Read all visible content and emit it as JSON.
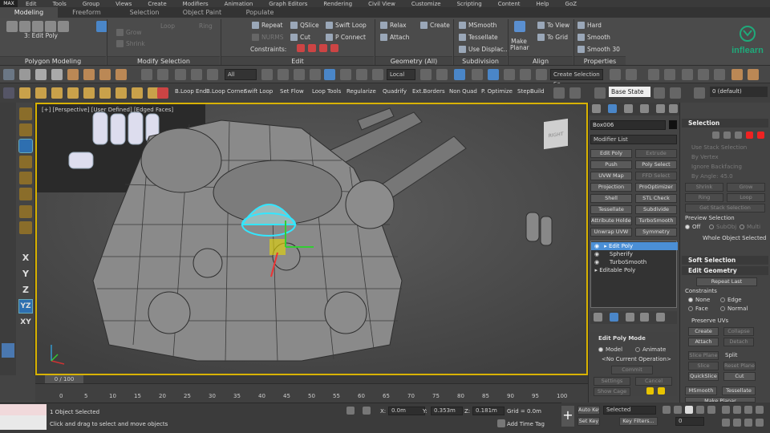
{
  "menubar": {
    "logo": "MAX",
    "items": [
      "Edit",
      "Tools",
      "Group",
      "Views",
      "Create",
      "Modifiers",
      "Animation",
      "Graph Editors",
      "Rendering",
      "Civil View",
      "Customize",
      "Scripting",
      "Content",
      "Help",
      "GoZ"
    ]
  },
  "ribbon_tabs": [
    "Modeling",
    "Freeform",
    "Selection",
    "Object Paint",
    "Populate"
  ],
  "ribbon": {
    "edit_poly_label": "3: Edit Poly",
    "panels": [
      "Polygon Modeling",
      "Modify Selection",
      "Edit",
      "Geometry (All)",
      "Subdivision",
      "Align",
      "Properties"
    ],
    "modify_selection": [
      "Grow",
      "Shrink",
      "Loop",
      "Ring"
    ],
    "edit": [
      "Repeat",
      "QSlice",
      "Swift Loop",
      "NURMS",
      "Cut",
      "P Connect"
    ],
    "constraints_label": "Constraints:",
    "geometry": [
      "Relax",
      "Create",
      "Attach"
    ],
    "subdivision": [
      "MSmooth",
      "Tessellate",
      "Use Displac..."
    ],
    "make_planar": "Make Planar",
    "align": [
      "To View",
      "To Grid"
    ],
    "properties": [
      "Hard",
      "Smooth",
      "Smooth 30"
    ]
  },
  "toolbar": {
    "filter": "All",
    "coord": "Local",
    "selection_set": "Create Selection Se",
    "layer": "0 (default)"
  },
  "graphite_bar": {
    "items": [
      "B.Loop End",
      "B.Loop Corner",
      "Swift Loop",
      "Set Flow",
      "Loop Tools",
      "Regularize",
      "Quadrify",
      "Ext.Borders",
      "Non Quad",
      "P. Optimize",
      "StepBuild"
    ],
    "state_set": "Base State"
  },
  "left_tools": [
    "X",
    "Y",
    "Z",
    "YZ",
    "XY"
  ],
  "viewport": {
    "label": "[+] [Perspective] [User Defined] [Edged Faces]",
    "viewcube": "RIGHT"
  },
  "timeline": {
    "frame": "0 / 100",
    "ticks": [
      "0",
      "5",
      "10",
      "15",
      "20",
      "25",
      "30",
      "35",
      "40",
      "45",
      "50",
      "55",
      "60",
      "65",
      "70",
      "75",
      "80",
      "85",
      "90",
      "95",
      "100"
    ]
  },
  "status": {
    "selected": "1 Object Selected",
    "prompt": "Click and drag to select and move objects",
    "x": "0.0m",
    "y": "0.353m",
    "z": "0.181m",
    "grid": "Grid = 0.0m",
    "add_time_tag": "Add Time Tag",
    "auto_key": "Auto Key",
    "set_key": "Set Key",
    "key_selected": "Selected",
    "key_filters": "Key Filters...",
    "frame_field": "0"
  },
  "command_panel": {
    "object_name": "Box006",
    "modifier_list": "Modifier List",
    "buttons": [
      [
        "Edit Poly",
        "Extrude"
      ],
      [
        "Push",
        "Poly Select"
      ],
      [
        "UVW Map",
        "FFD Select"
      ],
      [
        "Projection",
        "ProOptimizer"
      ],
      [
        "Shell",
        "STL Check"
      ],
      [
        "Tessellate",
        "Subdivide"
      ],
      [
        "Attribute Holder",
        "TurboSmooth"
      ],
      [
        "Unwrap UVW",
        "Symmetry"
      ]
    ],
    "stack": [
      "Edit Poly",
      "Spherify",
      "TurboSmooth",
      "Editable Poly"
    ],
    "edit_poly_mode": "Edit Poly Mode",
    "model": "Model",
    "animate": "Animate",
    "no_op": "<No Current Operation>",
    "commit": "Commit",
    "settings": "Settings",
    "cancel": "Cancel",
    "show_cage": "Show Cage"
  },
  "right_panel": {
    "selection": "Selection",
    "use_stack": "Use Stack Selection",
    "by_vertex": "By Vertex",
    "ignore_back": "Ignore Backfacing",
    "by_angle": "By Angle:",
    "angle": "45.0",
    "shrink": "Shrink",
    "grow": "Grow",
    "ring": "Ring",
    "loop": "Loop",
    "get_stack": "Get Stack Selection",
    "preview": "Preview Selection",
    "off": "Off",
    "subobj": "SubObj",
    "multi": "Multi",
    "whole": "Whole Object Selected",
    "soft": "Soft Selection",
    "edit_geometry": "Edit Geometry",
    "repeat_last": "Repeat Last",
    "constraints": "Constraints",
    "none": "None",
    "edge": "Edge",
    "face": "Face",
    "normal": "Normal",
    "preserve": "Preserve UVs",
    "create": "Create",
    "collapse": "Collapse",
    "attach": "Attach",
    "detach": "Detach",
    "slice_plane": "Slice Plane",
    "split": "Split",
    "slice": "Slice",
    "reset_plane": "Reset Plane",
    "quickslice": "QuickSlice",
    "cut": "Cut",
    "msmooth": "MSmooth",
    "tessellate": "Tessellate",
    "make_planar": "Make Planar"
  },
  "brand": "inflearn"
}
